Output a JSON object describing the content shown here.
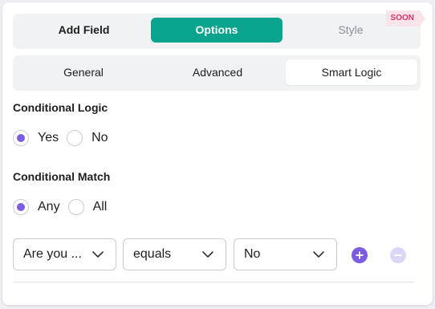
{
  "tabs": {
    "add_field": "Add Field",
    "options": "Options",
    "style": "Style",
    "style_badge": "SOON"
  },
  "subtabs": {
    "general": "General",
    "advanced": "Advanced",
    "smart_logic": "Smart Logic"
  },
  "conditional_logic": {
    "label": "Conditional Logic",
    "options": [
      "Yes",
      "No"
    ],
    "selected": "Yes"
  },
  "conditional_match": {
    "label": "Conditional Match",
    "options": [
      "Any",
      "All"
    ],
    "selected": "Any"
  },
  "rule": {
    "field": "Are you ...",
    "operator": "equals",
    "value": "No"
  },
  "colors": {
    "accent_teal": "#0aa38e",
    "accent_purple": "#7c5ce0",
    "badge_pink": "#d6336c"
  },
  "icons": {
    "dropdown": "chevron-down-icon",
    "add": "plus-icon",
    "remove": "minus-icon"
  }
}
